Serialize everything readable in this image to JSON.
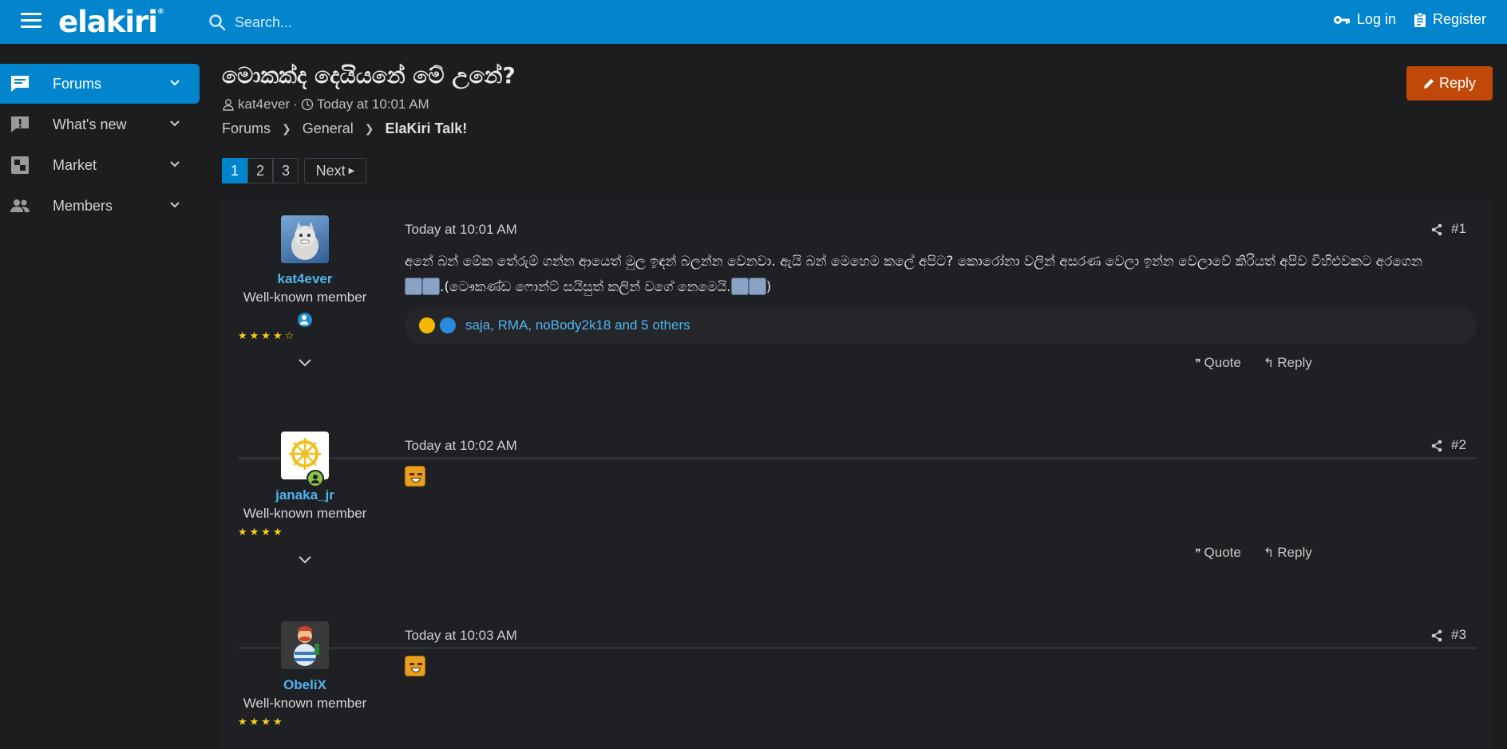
{
  "header": {
    "logo": "elakiri",
    "logo_mark": "®",
    "search_placeholder": "Search...",
    "login_label": "Log in",
    "register_label": "Register"
  },
  "sidebar": {
    "items": [
      {
        "label": "Forums",
        "icon": "forums-icon",
        "active": true
      },
      {
        "label": "What's new",
        "icon": "whats-new-icon"
      },
      {
        "label": "Market",
        "icon": "market-icon"
      },
      {
        "label": "Members",
        "icon": "members-icon"
      }
    ]
  },
  "thread": {
    "title": "මොකක්ද දෙයියනේ මේ උනේ?",
    "author": "kat4ever",
    "meta_sep": "·",
    "date": "Today at 10:01 AM",
    "reply_label": "Reply"
  },
  "breadcrumb": [
    "Forums",
    "General",
    "ElaKiri Talk!"
  ],
  "pagination": {
    "pages": [
      "1",
      "2",
      "3"
    ],
    "current": "1",
    "next_label": "Next"
  },
  "posts": [
    {
      "username": "kat4ever",
      "user_title": "Well-known member",
      "stars": "★★★★☆",
      "date": "Today at 10:01 AM",
      "number": "#1",
      "body_part1": "අනේ බන් මේක තේරුම් ගන්න ආයෙත් මුල ඉඳන් බලන්න වෙනවා. ඇයි බන් මෙහෙම කලේ අපිට? කොරෝනා වලින් අසරණ වෙලා ඉන්න වෙලාවේ කිරියත් අපිව විහිළුවකට අරගෙන",
      "body_part2": ".(ටෞකණ්ඩ ෆොන්ට් සයිසුත් කලින් වගේ නෙමෙයි.",
      "body_part3": ")",
      "reactions_text": "saja, RMA, noBody2k18 and 5 others",
      "quote_label": "Quote",
      "reply_label": "Reply"
    },
    {
      "username": "janaka_jr",
      "user_title": "Well-known member",
      "stars": "★★★★",
      "date": "Today at 10:02 AM",
      "number": "#2",
      "quote_label": "Quote",
      "reply_label": "Reply"
    },
    {
      "username": "ObeliX",
      "user_title": "Well-known member",
      "stars": "★★★★",
      "date": "Today at 10:03 AM",
      "number": "#3"
    }
  ],
  "colors": {
    "header_bg": "#0285cc",
    "page_bg": "#1c1d1f",
    "reply_button": "#c04808",
    "username": "#4fb4f0",
    "stars": "#f3d01a"
  }
}
